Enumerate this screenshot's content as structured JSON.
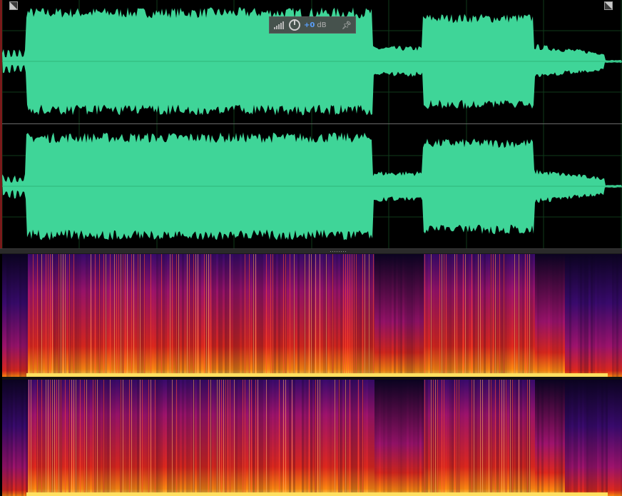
{
  "app": "Audio editor",
  "waveform": {
    "channels": [
      "left",
      "right"
    ],
    "color": "#3fd598",
    "background": "#000000"
  },
  "spectral": {
    "channels": [
      "left",
      "right"
    ],
    "palette": [
      "#0b0320",
      "#3a0a6e",
      "#a0136d",
      "#e0281c",
      "#ff8a10",
      "#ffe060"
    ]
  },
  "hud": {
    "gain_value": "+0",
    "gain_unit": "dB",
    "level_icon": "signal-bars-icon",
    "knob_icon": "volume-knob-icon",
    "pin_icon": "pin-icon"
  },
  "corners": {
    "left_icon": "zoom-in-corner-icon",
    "right_icon": "zoom-out-corner-icon"
  },
  "splitter_icon": "splitter-grip-icon"
}
